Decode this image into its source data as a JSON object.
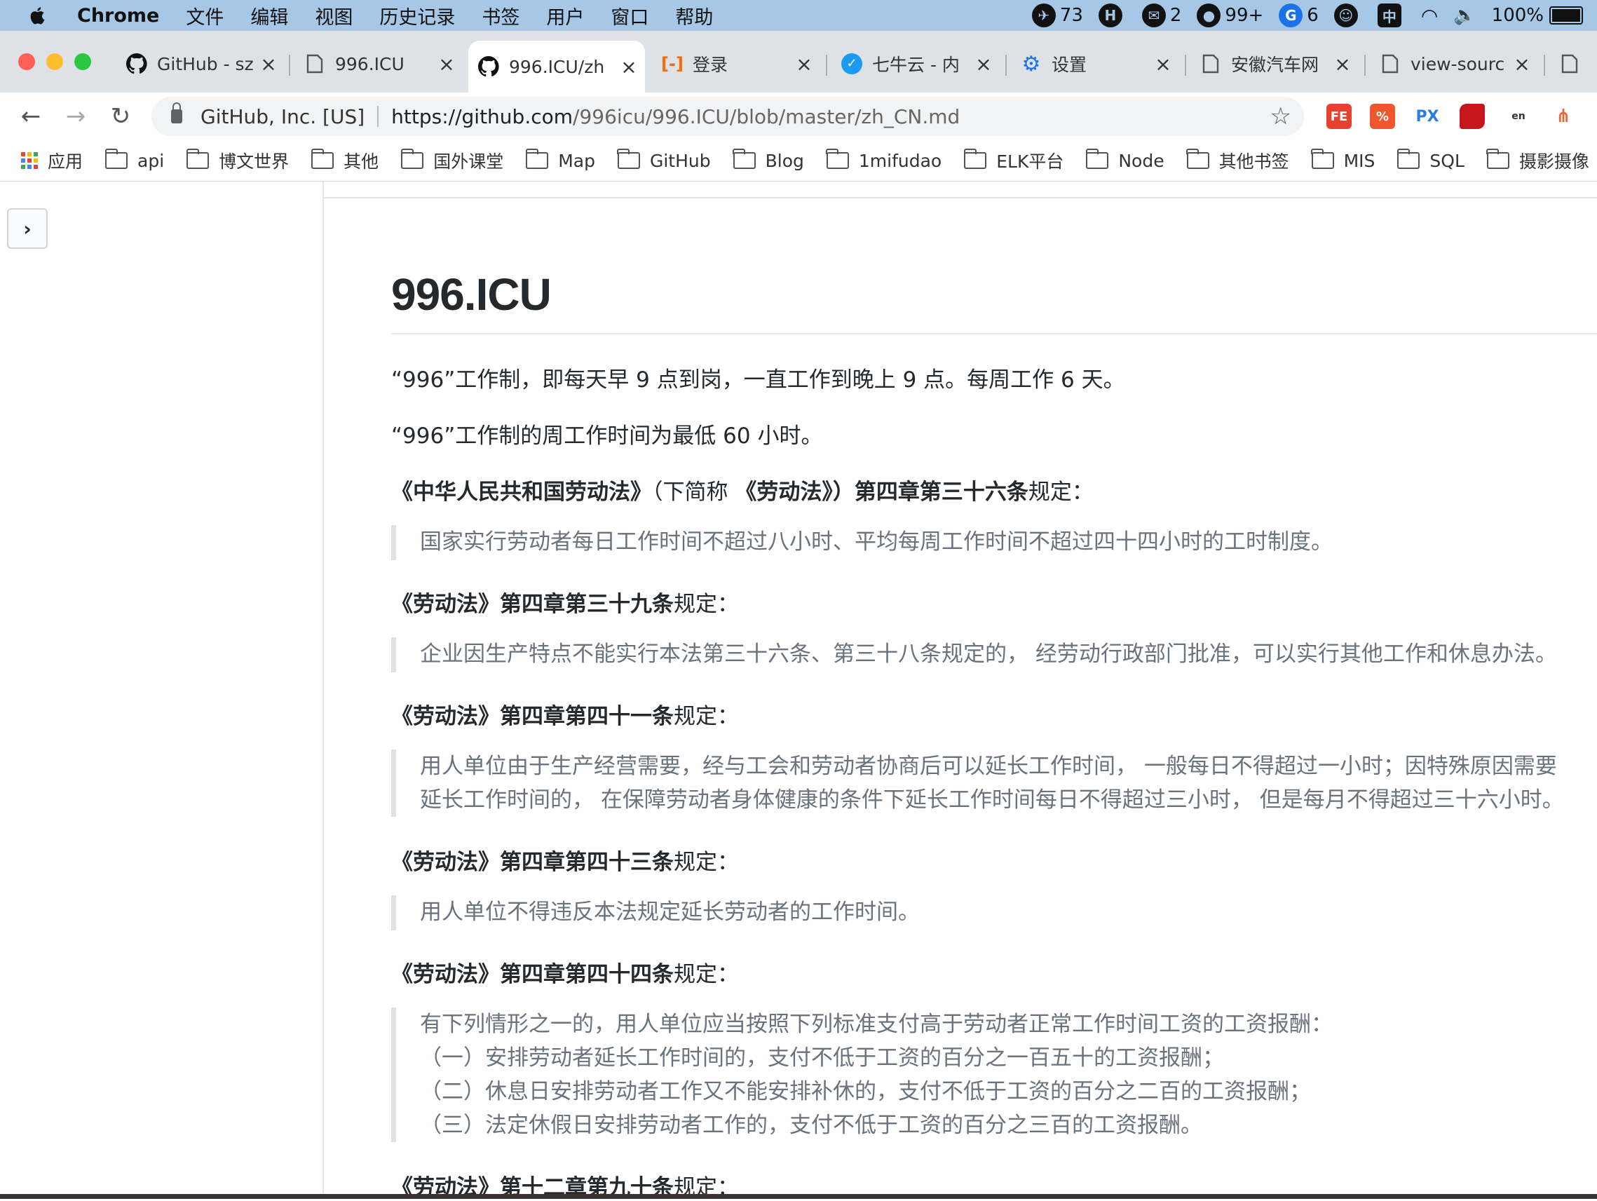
{
  "menubar": {
    "app": "Chrome",
    "menus": [
      "文件",
      "编辑",
      "视图",
      "历史记录",
      "书签",
      "用户",
      "窗口",
      "帮助"
    ],
    "status": {
      "tg_count": "73",
      "h_label": "H",
      "wechat_count": "2",
      "qq_count": "99+",
      "g_count": "6",
      "battery": "100%"
    }
  },
  "tabs": [
    {
      "title": "GitHub - sz",
      "icon": "github-icon"
    },
    {
      "title": "996.ICU",
      "icon": "page-icon"
    },
    {
      "title": "996.ICU/zh",
      "icon": "github-icon",
      "active": true
    },
    {
      "title": "登录",
      "icon": "aliyun-icon"
    },
    {
      "title": "七牛云 - 内",
      "icon": "qiniu-icon"
    },
    {
      "title": "设置",
      "icon": "gear-icon"
    },
    {
      "title": "安徽汽车网",
      "icon": "page-icon"
    },
    {
      "title": "view-sourc",
      "icon": "page-icon"
    }
  ],
  "omnibox": {
    "site_identity": "GitHub, Inc. [US]",
    "url_host": "https://github.com",
    "url_path": "/996icu/996.ICU/blob/master/zh_CN.md"
  },
  "extensions": [
    "FE",
    "%",
    "PX",
    "",
    "",
    ""
  ],
  "bookmarks": {
    "apps_label": "应用",
    "items": [
      "api",
      "博文世界",
      "其他",
      "国外课堂",
      "Map",
      "GitHub",
      "Blog",
      "1mifudao",
      "ELK平台",
      "Node",
      "其他书签",
      "MIS",
      "SQL",
      "摄影摄像"
    ]
  },
  "doc": {
    "title": "996.ICU",
    "p1": "“996”工作制，即每天早 9 点到岗，一直工作到晚上 9 点。每周工作 6 天。",
    "p2": "“996”工作制的周工作时间为最低 60 小时。",
    "h1_bold": "《中华人民共和国劳动法》",
    "h1_mid": "（下简称",
    "h1_bold2": "《劳动法》",
    "h1_bold3": "）第四章第三十六条",
    "h1_tail": "规定：",
    "q1": "国家实行劳动者每日工作时间不超过八小时、平均每周工作时间不超过四十四小时的工时制度。",
    "h2_bold": "《劳动法》第四章第三十九条",
    "h2_tail": "规定：",
    "q2": "企业因生产特点不能实行本法第三十六条、第三十八条规定的， 经劳动行政部门批准，可以实行其他工作和休息办法。",
    "h3_bold": "《劳动法》第四章第四十一条",
    "h3_tail": "规定：",
    "q3_line1": "用人单位由于生产经营需要，经与工会和劳动者协商后可以延长工作时间， 一般每日不得超过一小时；因特殊原因需要",
    "q3_line2": "延长工作时间的， 在保障劳动者身体健康的条件下延长工作时间每日不得超过三小时， 但是每月不得超过三十六小时。",
    "h4_bold": "《劳动法》第四章第四十三条",
    "h4_tail": "规定：",
    "q4": "用人单位不得违反本法规定延长劳动者的工作时间。",
    "h5_bold": "《劳动法》第四章第四十四条",
    "h5_tail": "规定：",
    "q5_line1": "有下列情形之一的，用人单位应当按照下列标准支付高于劳动者正常工作时间工资的工资报酬：",
    "q5_line2": "（一）安排劳动者延长工作时间的，支付不低于工资的百分之一百五十的工资报酬；",
    "q5_line3": "（二）休息日安排劳动者工作又不能安排补休的，支付不低于工资的百分之二百的工资报酬；",
    "q5_line4": "（三）法定休假日安排劳动者工作的，支付不低于工资的百分之三百的工资报酬。",
    "h6_bold": "《劳动法》第十二章第九十条",
    "h6_tail": "规定："
  },
  "colors": {
    "menubar_bg": "#a7c7e7",
    "tabstrip_bg": "#dee1e6",
    "close_red": "#ff5f57",
    "min_yellow": "#febc2e",
    "max_green": "#28c840",
    "quote_text": "#6a737d",
    "quote_border": "#dfe2e5"
  }
}
